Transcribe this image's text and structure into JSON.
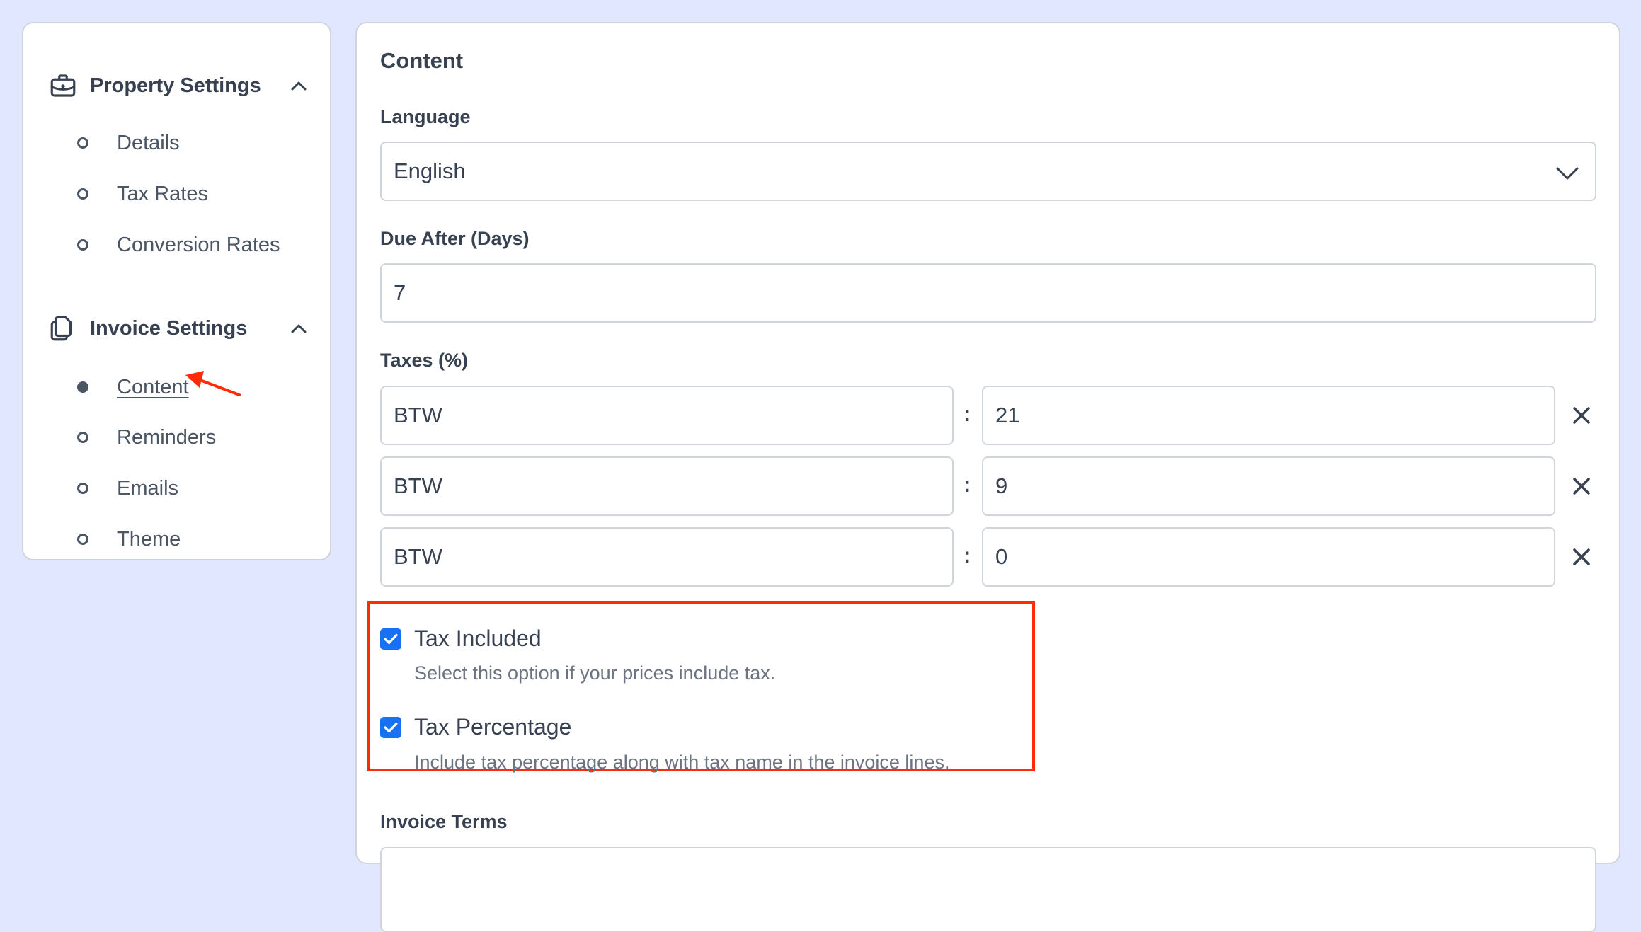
{
  "sidebar": {
    "sections": [
      {
        "title": "Property Settings",
        "icon": "briefcase-icon",
        "expanded": true,
        "items": [
          {
            "label": "Details",
            "active": false
          },
          {
            "label": "Tax Rates",
            "active": false
          },
          {
            "label": "Conversion Rates",
            "active": false
          }
        ]
      },
      {
        "title": "Invoice Settings",
        "icon": "documents-icon",
        "expanded": true,
        "items": [
          {
            "label": "Content",
            "active": true
          },
          {
            "label": "Reminders",
            "active": false
          },
          {
            "label": "Emails",
            "active": false
          },
          {
            "label": "Theme",
            "active": false
          }
        ]
      }
    ]
  },
  "main": {
    "title": "Content",
    "language": {
      "label": "Language",
      "value": "English"
    },
    "due_after": {
      "label": "Due After (Days)",
      "value": "7"
    },
    "taxes": {
      "label": "Taxes (%)",
      "separator": ":",
      "rows": [
        {
          "name": "BTW",
          "rate": "21"
        },
        {
          "name": "BTW",
          "rate": "9"
        },
        {
          "name": "BTW",
          "rate": "0"
        }
      ]
    },
    "tax_included": {
      "label": "Tax Included",
      "checked": true,
      "help": "Select this option if your prices include tax."
    },
    "tax_percentage": {
      "label": "Tax Percentage",
      "checked": true,
      "help": "Include tax percentage along with tax name in the invoice lines."
    },
    "invoice_terms": {
      "label": "Invoice Terms",
      "value": ""
    }
  },
  "annotations": {
    "highlight_color": "#ff2a0a",
    "arrow_target": "Content"
  },
  "colors": {
    "page_bg": "#e0e7ff",
    "checkbox": "#1672f3",
    "text": "#374151"
  }
}
